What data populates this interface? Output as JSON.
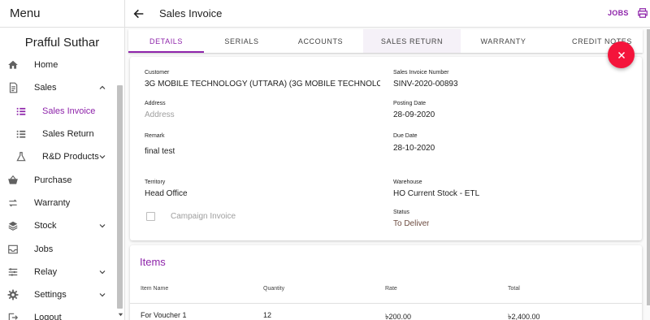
{
  "sidebar": {
    "menu_title": "Menu",
    "user_name": "Prafful Suthar",
    "items": [
      {
        "label": "Home",
        "icon": "home-icon"
      },
      {
        "label": "Sales",
        "icon": "receipt-icon",
        "expanded": true
      },
      {
        "label": "Sales Invoice",
        "icon": "list-icon",
        "active": true
      },
      {
        "label": "Sales Return",
        "icon": "list-icon"
      },
      {
        "label": "R&D Products",
        "icon": "flask-icon"
      },
      {
        "label": "Purchase",
        "icon": "basket-icon"
      },
      {
        "label": "Warranty",
        "icon": "swap-icon"
      },
      {
        "label": "Stock",
        "icon": "layers-icon"
      },
      {
        "label": "Jobs",
        "icon": "inbox-icon"
      },
      {
        "label": "Relay",
        "icon": "tune-icon"
      },
      {
        "label": "Settings",
        "icon": "gear-icon"
      },
      {
        "label": "Logout",
        "icon": "logout-icon"
      }
    ]
  },
  "header": {
    "title": "Sales Invoice",
    "jobs_label": "JOBS"
  },
  "tabs": [
    "DETAILS",
    "SERIALS",
    "ACCOUNTS",
    "SALES RETURN",
    "WARRANTY",
    "CREDIT NOTES"
  ],
  "details": {
    "customer_label": "Customer",
    "customer_value": "3G MOBILE TECHNOLOGY (UTTARA) (3G MOBILE TECHNOLOGY (UT",
    "invoice_number_label": "Sales Invoice Number",
    "invoice_number_value": "SINV-2020-00893",
    "address_label": "Address",
    "address_placeholder": "Address",
    "posting_date_label": "Posting Date",
    "posting_date_value": "28-09-2020",
    "remark_label": "Remark",
    "remark_value": "final test",
    "due_date_label": "Due Date",
    "due_date_value": "28-10-2020",
    "territory_label": "Territory",
    "territory_value": "Head Office",
    "warehouse_label": "Warehouse",
    "warehouse_value": "HO Current Stock - ETL",
    "campaign_label": "Campaign Invoice",
    "status_label": "Status",
    "status_value": "To Deliver"
  },
  "items": {
    "title": "Items",
    "columns": [
      "Item Name",
      "Quantity",
      "Rate",
      "Total"
    ],
    "rows": [
      {
        "name": "For Voucher 1",
        "quantity": "12",
        "rate": "৳200.00",
        "total": "৳2,400.00"
      }
    ]
  },
  "colors": {
    "accent": "#8e24aa",
    "fab": "#f4143b",
    "status": "#6d4c41"
  }
}
